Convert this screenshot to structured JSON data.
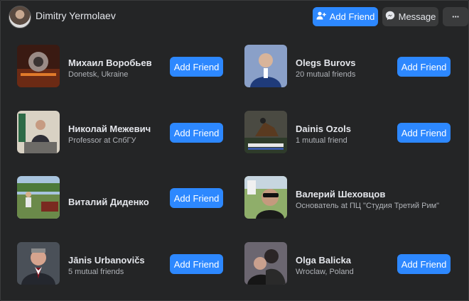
{
  "profile": {
    "name": "Dimitry Yermolaev"
  },
  "header": {
    "add_friend_label": "Add Friend",
    "message_label": "Message",
    "more_label": "···"
  },
  "friends": [
    {
      "name": "Михаил Воробьев",
      "subtitle": "Donetsk, Ukraine",
      "button": "Add Friend"
    },
    {
      "name": "Olegs Burovs",
      "subtitle": "20 mutual friends",
      "button": "Add Friend"
    },
    {
      "name": "Николай Межевич",
      "subtitle": "Professor at СпбГУ",
      "button": "Add Friend"
    },
    {
      "name": "Dainis Ozols",
      "subtitle": "1 mutual friend",
      "button": "Add Friend"
    },
    {
      "name": "Виталий Диденко",
      "subtitle": "",
      "button": "Add Friend"
    },
    {
      "name": "Валерий Шеховцов",
      "subtitle": "Основатель at ПЦ \"Студия Третий Рим\"",
      "button": ""
    },
    {
      "name": "Jānis Urbanovičs",
      "subtitle": "5 mutual friends",
      "button": "Add Friend"
    },
    {
      "name": "Olga Balicka",
      "subtitle": "Wroclaw, Poland",
      "button": "Add Friend"
    }
  ],
  "colors": {
    "accent": "#2d88ff",
    "panel": "#242526",
    "secondary_button": "#3a3b3c"
  }
}
